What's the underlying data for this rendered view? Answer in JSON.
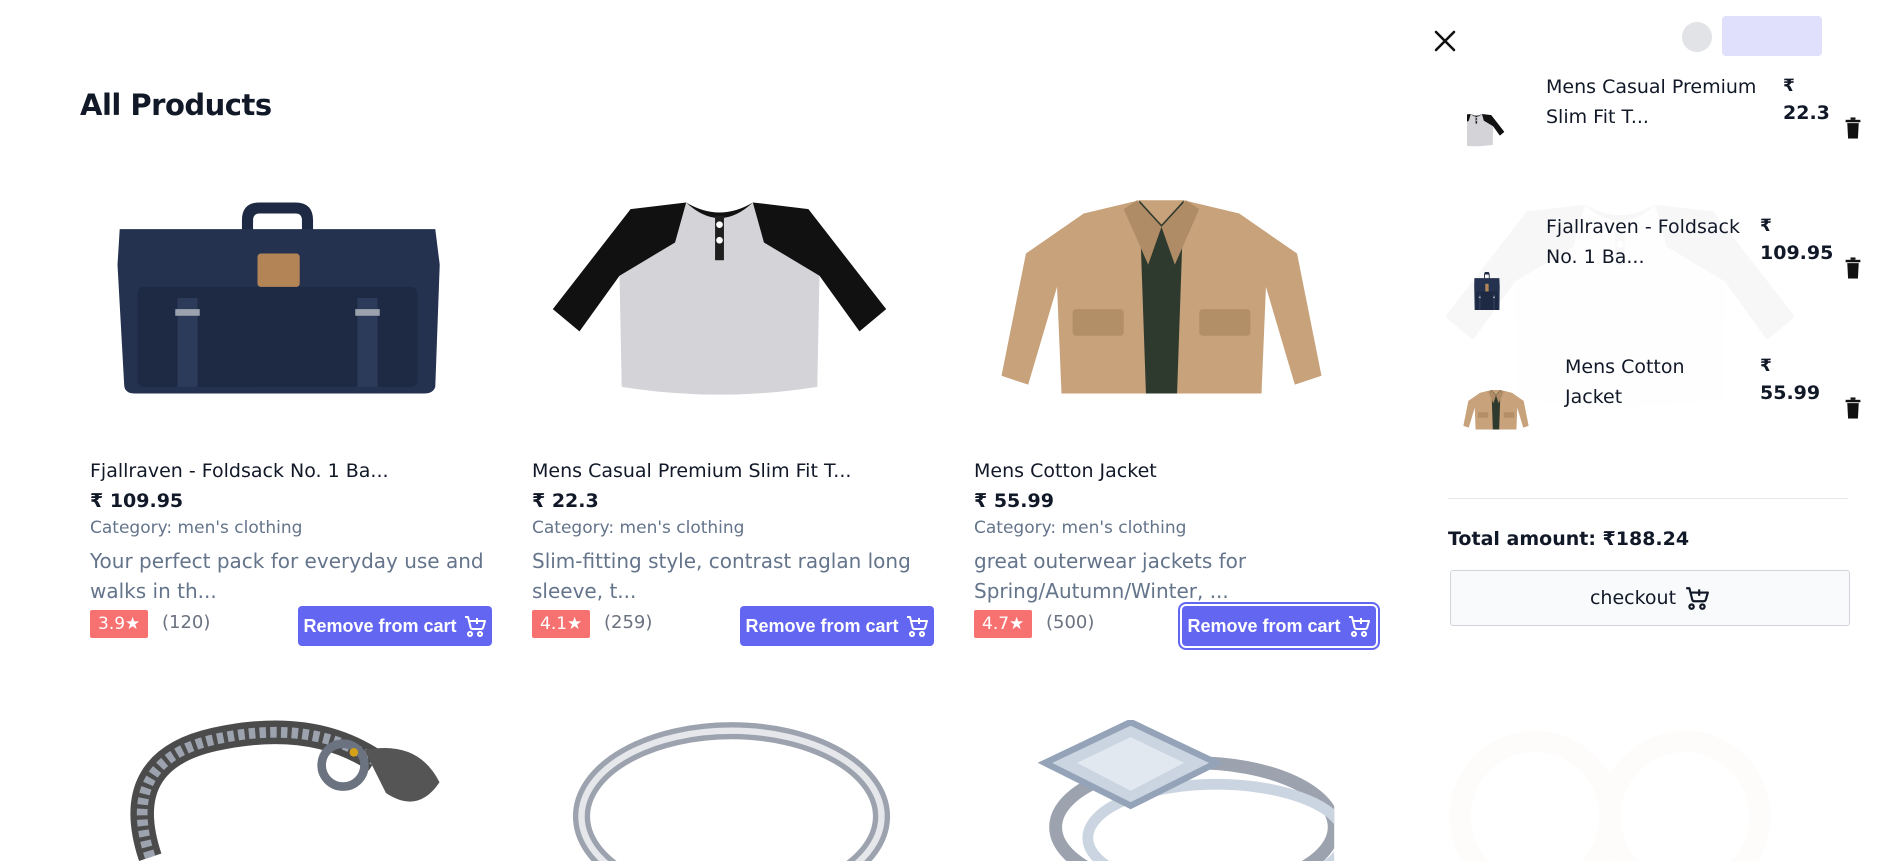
{
  "page": {
    "title": "All Products"
  },
  "products": [
    {
      "title": "Fjallraven - Foldsack No. 1 Ba...",
      "price": "₹ 109.95",
      "category": "Category: men's clothing",
      "description": "Your perfect pack for everyday use and walks in th...",
      "rating": "3.9★",
      "reviews": "(120)",
      "button_label": "Remove from cart",
      "image": "backpack-image"
    },
    {
      "title": "Mens Casual Premium Slim Fit T...",
      "price": "₹ 22.3",
      "category": "Category: men's clothing",
      "description": "Slim-fitting style, contrast raglan long sleeve, t...",
      "rating": "4.1★",
      "reviews": "(259)",
      "button_label": "Remove from cart",
      "image": "raglan-tshirt-image"
    },
    {
      "title": "Mens Cotton Jacket",
      "price": "₹ 55.99",
      "category": "Category: men's clothing",
      "description": "great outerwear jackets for Spring/Autumn/Winter, ...",
      "rating": "4.7★",
      "reviews": "(500)",
      "button_label": "Remove from cart",
      "image": "cotton-jacket-image"
    }
  ],
  "second_row_images": [
    "chain-bracelet-image",
    "silver-ring-image",
    "diamond-ring-image"
  ],
  "cart": {
    "items": [
      {
        "name_line1": "Mens Casual Premium",
        "name_line2": "Slim Fit T...",
        "currency": "₹",
        "price": "22.3",
        "image": "raglan-tshirt-image"
      },
      {
        "name_line1": "Fjallraven - Foldsack",
        "name_line2": "No. 1 Ba...",
        "currency": "₹",
        "price": "109.95",
        "image": "backpack-image"
      },
      {
        "name_line1": "Mens Cotton",
        "name_line2": "Jacket",
        "currency": "₹",
        "price": "55.99",
        "image": "cotton-jacket-image"
      }
    ],
    "total": "Total amount: ₹188.24",
    "checkout_label": "checkout"
  },
  "colors": {
    "primary": "#6366f1",
    "rating_badge": "#f87171",
    "muted_text": "#64748b"
  },
  "icons": [
    "close-icon",
    "trash-icon",
    "add-to-cart-icon"
  ]
}
